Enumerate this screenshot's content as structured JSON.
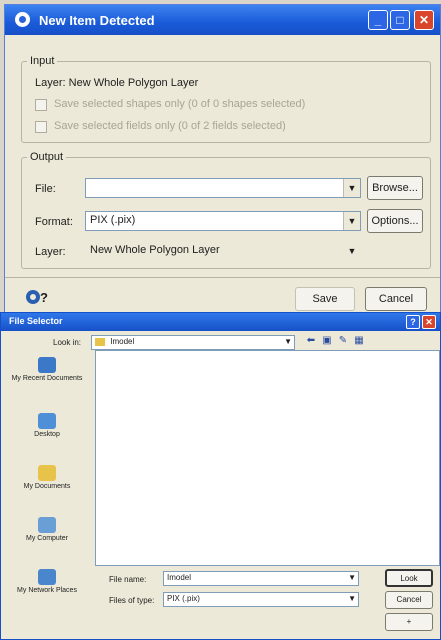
{
  "dialog": {
    "title": "New Item Detected",
    "input_group": {
      "label": "Input",
      "layer_text": "Layer:  New Whole Polygon Layer",
      "checkbox_shapes": "Save selected shapes only (0 of 0 shapes selected)",
      "checkbox_fields": "Save selected fields only (0 of 2 fields selected)"
    },
    "output_group": {
      "label": "Output",
      "file_label": "File:",
      "file_value": "",
      "browse_label": "Browse...",
      "format_label": "Format:",
      "format_value": "PIX (.pix)",
      "options_label": "Options...",
      "layer_label": "Layer:",
      "layer_value": "New Whole Polygon Layer"
    },
    "help_icon": "help-icon",
    "save_label": "Save",
    "cancel_label": "Cancel"
  },
  "file_selector": {
    "title": "File Selector",
    "look_in_label": "Look in:",
    "look_in_value": "Imodel",
    "places": [
      {
        "label": "My Recent Documents"
      },
      {
        "label": "Desktop"
      },
      {
        "label": "My Documents"
      },
      {
        "label": "My Computer"
      },
      {
        "label": "My Network Places"
      }
    ],
    "file_name_label": "File name:",
    "file_name_value": "Imodel",
    "file_type_label": "Files of type:",
    "file_type_value": "PIX (.pix)",
    "open_label": "Look",
    "cancel_label": "Cancel",
    "extra_label": "+"
  }
}
